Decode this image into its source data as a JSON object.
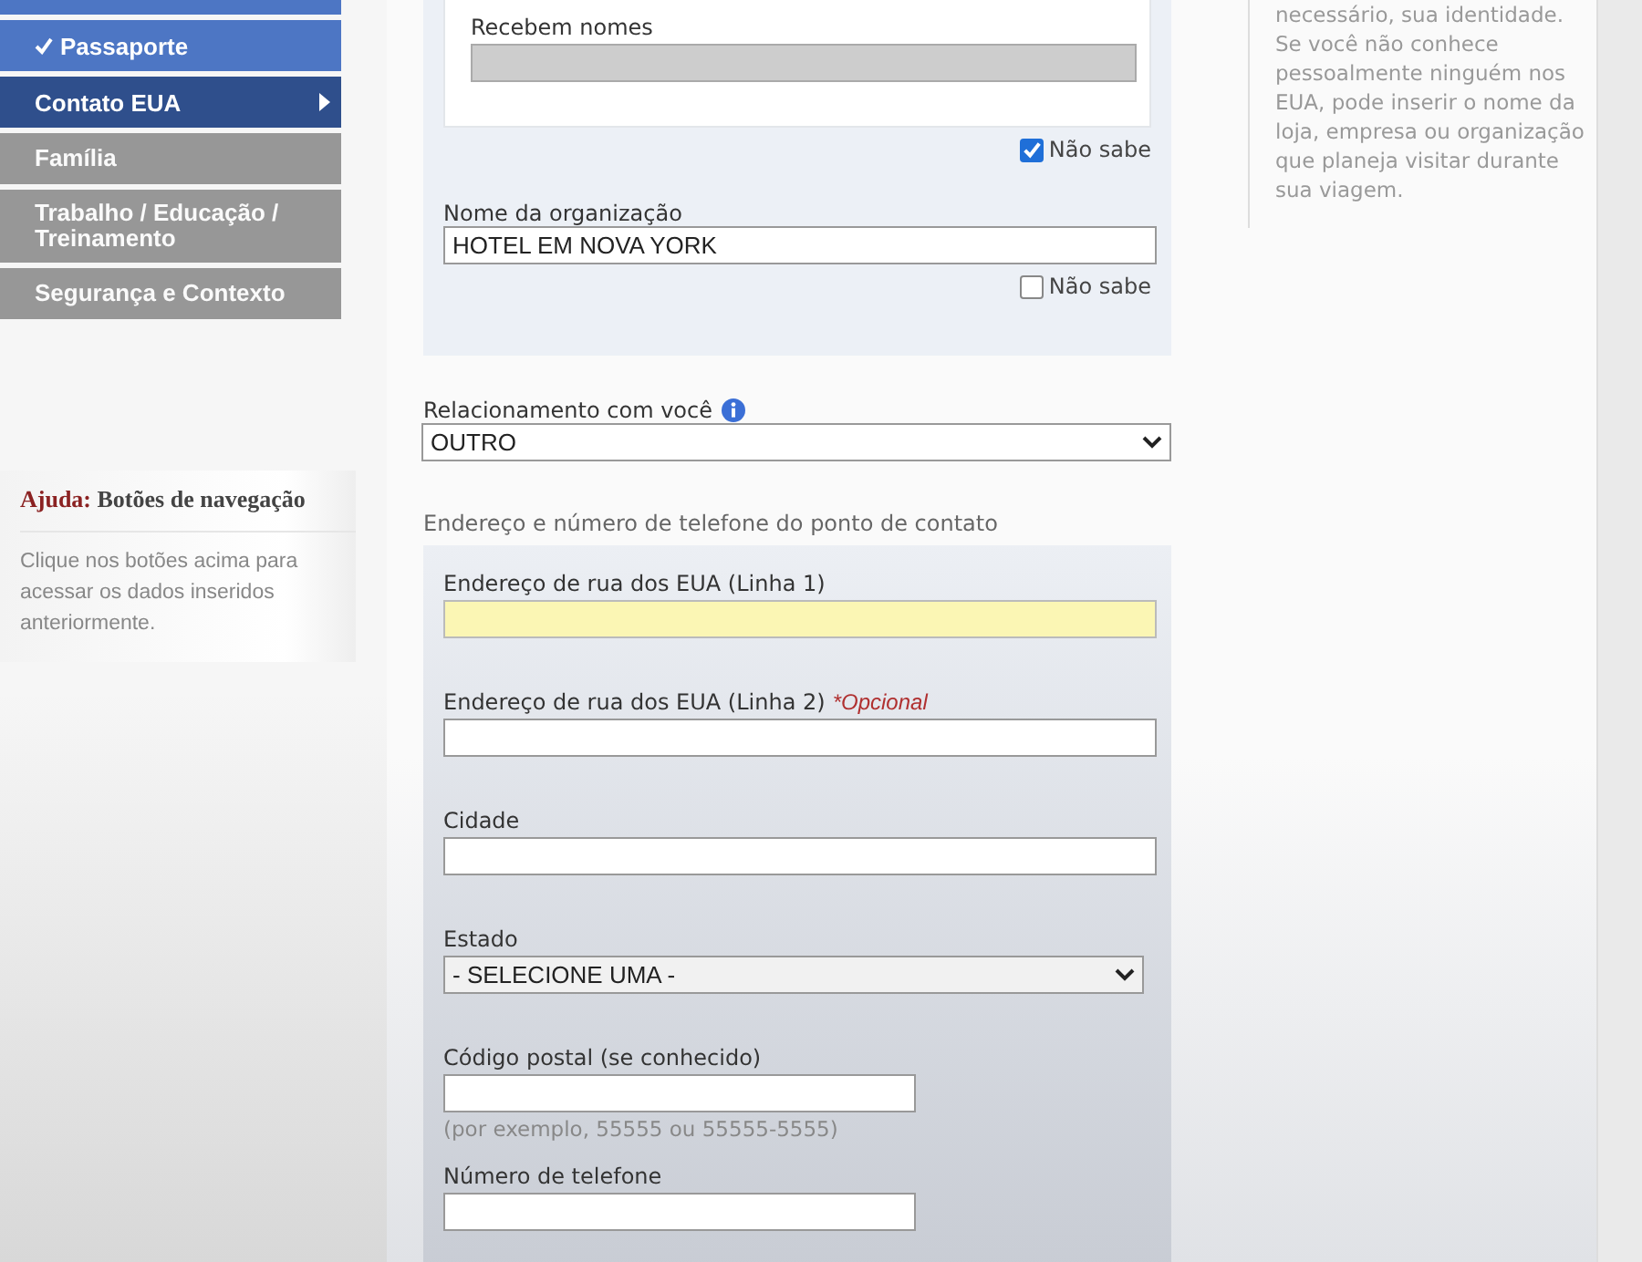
{
  "sidebar": {
    "items": [
      {
        "completed": true,
        "selected": false,
        "disabled": false
      },
      {
        "label": "Passaporte",
        "completed": true,
        "selected": false,
        "disabled": false
      },
      {
        "label": "Contato EUA",
        "completed": false,
        "selected": true,
        "disabled": false
      },
      {
        "label": "Família",
        "completed": false,
        "selected": false,
        "disabled": true
      },
      {
        "label": "Trabalho / Educação / Treinamento",
        "completed": false,
        "selected": false,
        "disabled": true
      },
      {
        "label": "Segurança e Contexto",
        "completed": false,
        "selected": false,
        "disabled": true
      }
    ]
  },
  "help_box": {
    "title": "Ajuda:",
    "subtitle": "Botões de navegação",
    "text": "Clique nos botões acima para acessar os dados inseridos anteriormente."
  },
  "contact_panel": {
    "names_field": {
      "label": "Recebem nomes",
      "disabled": true
    },
    "names_unknown": {
      "label": "Não sabe",
      "checked": true
    },
    "organization": {
      "label": "Nome da organização",
      "value": "HOTEL EM NOVA YORK"
    },
    "organization_unknown": {
      "label": "Não sabe",
      "checked": false
    }
  },
  "relationship": {
    "label": "Relacionamento com você",
    "value": "OUTRO"
  },
  "address_section": {
    "title": "Endereço e número de telefone do ponto de contato",
    "fields": [
      {
        "kind": "text",
        "label": "Endereço de rua dos EUA (Linha 1)",
        "focused": true
      },
      {
        "kind": "text",
        "label": "Endereço de rua dos EUA (Linha 2)",
        "note": "*Opcional",
        "focused": false
      },
      {
        "kind": "text",
        "label": "Cidade",
        "focused": false
      },
      {
        "kind": "select",
        "label": "Estado",
        "value": "- SELECIONE UMA -",
        "focused": false
      },
      {
        "kind": "short",
        "label": "Código postal (se conhecido)",
        "hint": "(por exemplo, 55555 ou 55555-5555)",
        "focused": false
      },
      {
        "kind": "short",
        "label": "Número de telefone",
        "focused": false
      }
    ]
  },
  "side_help": {
    "text": "necessário, sua identidade. Se você não conhece pessoalmente ninguém nos EUA, pode inserir o nome da loja, empresa ou organização que planeja visitar durante sua viagem."
  }
}
